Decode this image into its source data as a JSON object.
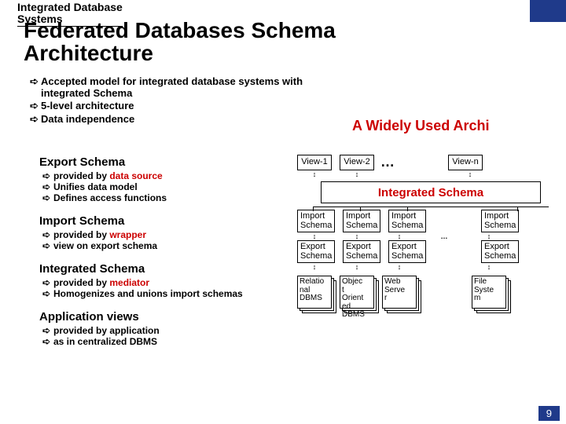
{
  "header_label": "Integrated Database\nSystems",
  "title": "Federated Databases Schema\nArchitecture",
  "top_bullets": [
    "Accepted model for integrated database systems with integrated Schema",
    "5-level architecture",
    "Data independence"
  ],
  "wide_arch": "A Widely Used Archi",
  "sections": [
    {
      "heading": "Export Schema",
      "items": [
        {
          "pre": "provided by ",
          "red": "data source",
          "post": ""
        },
        {
          "pre": "Unifies data model",
          "red": "",
          "post": ""
        },
        {
          "pre": "Defines access functions",
          "red": "",
          "post": ""
        }
      ]
    },
    {
      "heading": "Import Schema",
      "items": [
        {
          "pre": "provided by ",
          "red": "wrapper",
          "post": ""
        },
        {
          "pre": "view on export schema",
          "red": "",
          "post": ""
        }
      ]
    },
    {
      "heading": "Integrated Schema",
      "items": [
        {
          "pre": "provided by ",
          "red": "mediator",
          "post": ""
        },
        {
          "pre": "Homogenizes and unions import schemas",
          "red": "",
          "post": ""
        }
      ]
    },
    {
      "heading": "Application views",
      "items": [
        {
          "pre": "provided by application",
          "red": "",
          "post": ""
        },
        {
          "pre": "as in centralized DBMS",
          "red": "",
          "post": ""
        }
      ]
    }
  ],
  "views": [
    "View-1",
    "View-2",
    "View-n"
  ],
  "integrated_schema_label": "Integrated Schema",
  "import_label": "Import\nSchema",
  "export_label": "Export\nSchema",
  "dbs": [
    "Relatio\nnal\nDBMS",
    "Objec\nt\nOrient\ned\nDBMS",
    "Web\nServe\nr",
    "File\nSyste\nm"
  ],
  "ellipsis": "…",
  "arrow_glyph": "➪",
  "updown": "↕",
  "slide_num": "9"
}
